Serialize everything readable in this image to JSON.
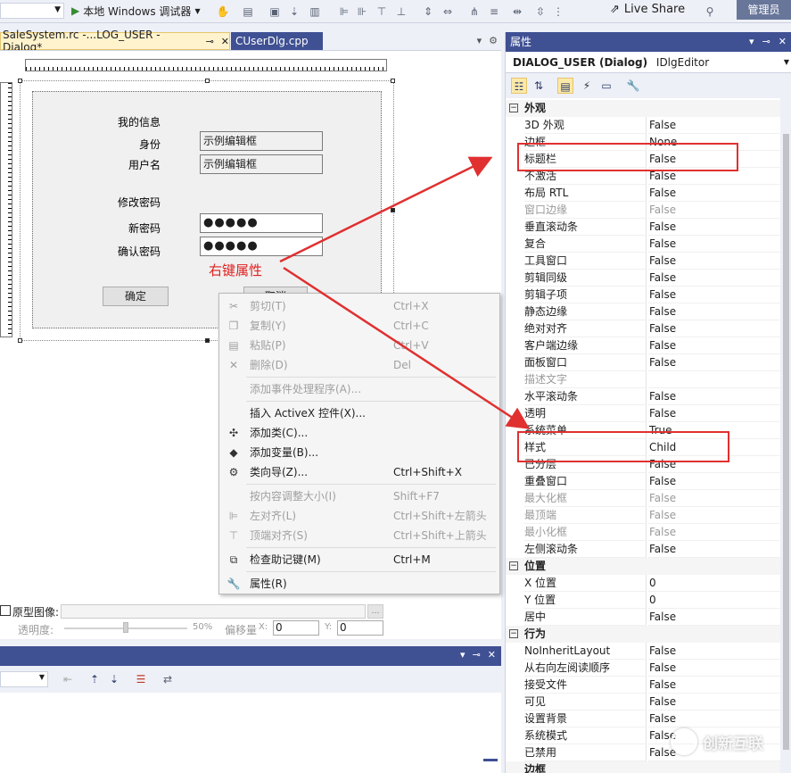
{
  "toolbar": {
    "run_label": "本地 Windows 调试器",
    "live_share": "Live Share",
    "admin": "管理员"
  },
  "tabs": [
    {
      "label": "SaleSystem.rc -...LOG_USER - Dialog*"
    },
    {
      "label": "CUserDlg.cpp"
    }
  ],
  "dialog": {
    "my_info": "我的信息",
    "identity_label": "身份",
    "identity_value": "示例编辑框",
    "username_label": "用户名",
    "username_value": "示例编辑框",
    "change_pw": "修改密码",
    "new_pw_label": "新密码",
    "new_pw_value": "●●●●●",
    "confirm_pw_label": "确认密码",
    "confirm_pw_value": "●●●●●",
    "ok_button": "确定",
    "cancel_button": "取消"
  },
  "annotation": "右键属性",
  "context_menu": [
    {
      "label": "剪切(T)",
      "shortcut": "Ctrl+X",
      "disabled": true,
      "icon": "scissors-icon"
    },
    {
      "label": "复制(Y)",
      "shortcut": "Ctrl+C",
      "disabled": true,
      "icon": "copy-icon"
    },
    {
      "label": "粘贴(P)",
      "shortcut": "Ctrl+V",
      "disabled": true,
      "icon": "paste-icon"
    },
    {
      "label": "删除(D)",
      "shortcut": "Del",
      "disabled": true,
      "icon": "delete-icon"
    },
    {
      "label": "添加事件处理程序(A)...",
      "shortcut": "",
      "disabled": true,
      "icon": ""
    },
    {
      "label": "插入 ActiveX 控件(X)...",
      "shortcut": "",
      "disabled": false,
      "icon": ""
    },
    {
      "label": "添加类(C)...",
      "shortcut": "",
      "disabled": false,
      "icon": "add-class-icon"
    },
    {
      "label": "添加变量(B)...",
      "shortcut": "",
      "disabled": false,
      "icon": "add-variable-icon"
    },
    {
      "label": "类向导(Z)...",
      "shortcut": "Ctrl+Shift+X",
      "disabled": false,
      "icon": "class-wizard-icon"
    },
    {
      "label": "按内容调整大小(I)",
      "shortcut": "Shift+F7",
      "disabled": true,
      "icon": ""
    },
    {
      "label": "左对齐(L)",
      "shortcut": "Ctrl+Shift+左箭头",
      "disabled": true,
      "icon": "align-left-icon"
    },
    {
      "label": "顶端对齐(S)",
      "shortcut": "Ctrl+Shift+上箭头",
      "disabled": true,
      "icon": "align-top-icon"
    },
    {
      "label": "检查助记键(M)",
      "shortcut": "Ctrl+M",
      "disabled": false,
      "icon": "mnemonic-icon"
    },
    {
      "label": "属性(R)",
      "shortcut": "",
      "disabled": false,
      "icon": "wrench-icon"
    }
  ],
  "editor_bottom": {
    "proto_label": "原型图像:",
    "opacity_label": "透明度:",
    "opacity_value": "50%",
    "offset_label": "偏移量",
    "x_label": "X:",
    "x_value": "0",
    "y_label": "Y:",
    "y_value": "0"
  },
  "properties": {
    "title": "属性",
    "object": "DIALOG_USER (Dialog)",
    "editor": "IDlgEditor",
    "categories": [
      {
        "name": "外观",
        "rows": [
          {
            "name": "3D 外观",
            "value": "False",
            "gray": false
          },
          {
            "name": "边框",
            "value": "None",
            "gray": false
          },
          {
            "name": "标题栏",
            "value": "False",
            "gray": false
          },
          {
            "name": "不激活",
            "value": "False",
            "gray": false
          },
          {
            "name": "布局 RTL",
            "value": "False",
            "gray": false
          },
          {
            "name": "窗口边缘",
            "value": "False",
            "gray": true
          },
          {
            "name": "垂直滚动条",
            "value": "False",
            "gray": false
          },
          {
            "name": "复合",
            "value": "False",
            "gray": false
          },
          {
            "name": "工具窗口",
            "value": "False",
            "gray": false
          },
          {
            "name": "剪辑同级",
            "value": "False",
            "gray": false
          },
          {
            "name": "剪辑子项",
            "value": "False",
            "gray": false
          },
          {
            "name": "静态边缘",
            "value": "False",
            "gray": false
          },
          {
            "name": "绝对对齐",
            "value": "False",
            "gray": false
          },
          {
            "name": "客户端边缘",
            "value": "False",
            "gray": false
          },
          {
            "name": "面板窗口",
            "value": "False",
            "gray": false
          },
          {
            "name": "描述文字",
            "value": "",
            "gray": true
          },
          {
            "name": "水平滚动条",
            "value": "False",
            "gray": false
          },
          {
            "name": "透明",
            "value": "False",
            "gray": false
          },
          {
            "name": "系统菜单",
            "value": "True",
            "gray": false
          },
          {
            "name": "样式",
            "value": "Child",
            "gray": false
          },
          {
            "name": "已分层",
            "value": "False",
            "gray": false
          },
          {
            "name": "重叠窗口",
            "value": "False",
            "gray": false
          },
          {
            "name": "最大化框",
            "value": "False",
            "gray": true
          },
          {
            "name": "最顶端",
            "value": "False",
            "gray": true
          },
          {
            "name": "最小化框",
            "value": "False",
            "gray": true
          },
          {
            "name": "左侧滚动条",
            "value": "False",
            "gray": false
          }
        ]
      },
      {
        "name": "位置",
        "rows": [
          {
            "name": "X 位置",
            "value": "0",
            "gray": false
          },
          {
            "name": "Y 位置",
            "value": "0",
            "gray": false
          },
          {
            "name": "居中",
            "value": "False",
            "gray": false
          }
        ]
      },
      {
        "name": "行为",
        "rows": [
          {
            "name": "NoInheritLayout",
            "value": "False",
            "gray": false
          },
          {
            "name": "从右向左阅读顺序",
            "value": "False",
            "gray": false
          },
          {
            "name": "接受文件",
            "value": "False",
            "gray": false
          },
          {
            "name": "可见",
            "value": "False",
            "gray": false
          },
          {
            "name": "设置背景",
            "value": "False",
            "gray": false
          },
          {
            "name": "系统模式",
            "value": "False",
            "gray": false
          },
          {
            "name": "已禁用",
            "value": "False",
            "gray": false
          }
        ]
      }
    ],
    "more_category": "边框"
  },
  "watermark": "创新互联",
  "colors": {
    "accent": "#3f5093",
    "annotation": "#e02020",
    "active_tab": "#fff3cd"
  }
}
